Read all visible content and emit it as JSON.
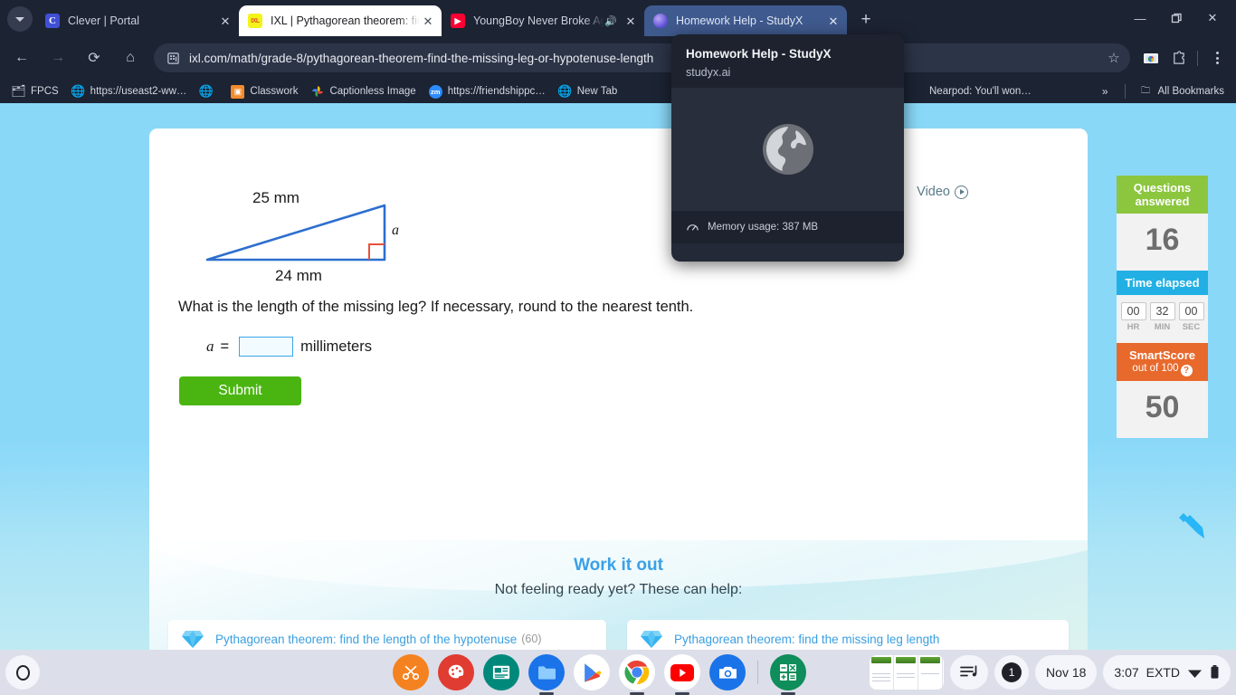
{
  "browser": {
    "tabs": [
      {
        "title": "Clever | Portal",
        "favicon": "clever-icon",
        "active": false,
        "audio": false
      },
      {
        "title": "IXL | Pythagorean theorem: find",
        "favicon": "ixl-icon",
        "active": true,
        "audio": false
      },
      {
        "title": "YoungBoy Never Broke Aga",
        "favicon": "youtube-icon",
        "active": false,
        "audio": true
      },
      {
        "title": "Homework Help - StudyX",
        "favicon": "studyx-icon",
        "active": false,
        "audio": false
      }
    ],
    "new_tab_label": "+",
    "window_controls": {
      "minimize": "—",
      "maximize": "❐",
      "close": "✕"
    },
    "toolbar": {
      "back": "←",
      "forward": "→",
      "reload": "⟳",
      "home": "⌂",
      "url": "ixl.com/math/grade-8/pythagorean-theorem-find-the-missing-leg-or-hypotenuse-length",
      "star": "☆",
      "extensions": "extensions-icon",
      "menu": "⋮"
    },
    "bookmarks": [
      {
        "label": "FPCS",
        "icon": "folder-gear-icon"
      },
      {
        "label": "https://useast2-ww…",
        "icon": "globe-icon"
      },
      {
        "label": "",
        "icon": "globe-icon"
      },
      {
        "label": "Classwork",
        "icon": "classroom-icon"
      },
      {
        "label": "Captionless Image",
        "icon": "photos-icon"
      },
      {
        "label": "https://friendshippc…",
        "icon": "zoom-icon"
      },
      {
        "label": "New Tab",
        "icon": "globe-icon"
      },
      {
        "label": "Nearpod: You'll won…",
        "icon": "nearpod-icon"
      }
    ],
    "bookmarks_overflow": "»",
    "all_bookmarks_label": "All Bookmarks"
  },
  "tab_preview": {
    "title": "Homework Help - StudyX",
    "domain": "studyx.ai",
    "memory": "Memory usage: 387 MB",
    "thumbnail_icon": "globe-icon",
    "memory_icon": "speedometer-icon"
  },
  "ixl": {
    "video_label": "Video",
    "question": "What is the length of the missing leg? If necessary, round to the nearest tenth.",
    "answer_prefix": "a",
    "answer_equals": "=",
    "answer_value": "",
    "answer_unit": "millimeters",
    "submit_label": "Submit",
    "diagram": {
      "hypotenuse_label": "25 mm",
      "base_label": "24 mm",
      "leg_label": "a",
      "right_angle_color": "#e8503a",
      "stroke_color": "#2d6fce"
    },
    "rail": {
      "questions_answered_label": "Questions answered",
      "questions_answered_value": "16",
      "time_elapsed_label": "Time elapsed",
      "timer": [
        {
          "value": "00",
          "unit": "HR"
        },
        {
          "value": "32",
          "unit": "MIN"
        },
        {
          "value": "00",
          "unit": "SEC"
        }
      ],
      "smartscore_label": "SmartScore",
      "smartscore_sub": "out of 100",
      "smartscore_help": "?",
      "smartscore_value": "50",
      "colors": {
        "green": "#8cc63e",
        "blue": "#22b0e4",
        "orange": "#e8692c"
      }
    },
    "pencil_icon": "pencil-icon",
    "work_it_out": {
      "title": "Work it out",
      "subtitle": "Not feeling ready yet? These can help:",
      "cards": [
        {
          "label": "Pythagorean theorem: find the length of the hypotenuse",
          "count": "(60)",
          "icon": "gem-icon"
        },
        {
          "label": "Pythagorean theorem: find the missing leg length",
          "count": "",
          "icon": "gem-icon"
        }
      ]
    }
  },
  "shelf": {
    "launcher_icon": "launcher-icon",
    "apps": [
      {
        "name": "snip-icon"
      },
      {
        "name": "paint-icon"
      },
      {
        "name": "news-icon"
      },
      {
        "name": "files-icon"
      },
      {
        "name": "play-store-icon"
      },
      {
        "name": "chrome-icon"
      },
      {
        "name": "youtube-icon"
      },
      {
        "name": "camera-icon"
      },
      {
        "name": "calculator-icon"
      }
    ],
    "tray": {
      "window_preview_icon": "window-preview-icon",
      "media_icon": "media-playlist-icon",
      "notification_count": "1",
      "date": "Nov 18",
      "time": "3:07",
      "status_label": "EXTD",
      "wifi_icon": "wifi-icon",
      "battery_icon": "battery-icon"
    }
  }
}
